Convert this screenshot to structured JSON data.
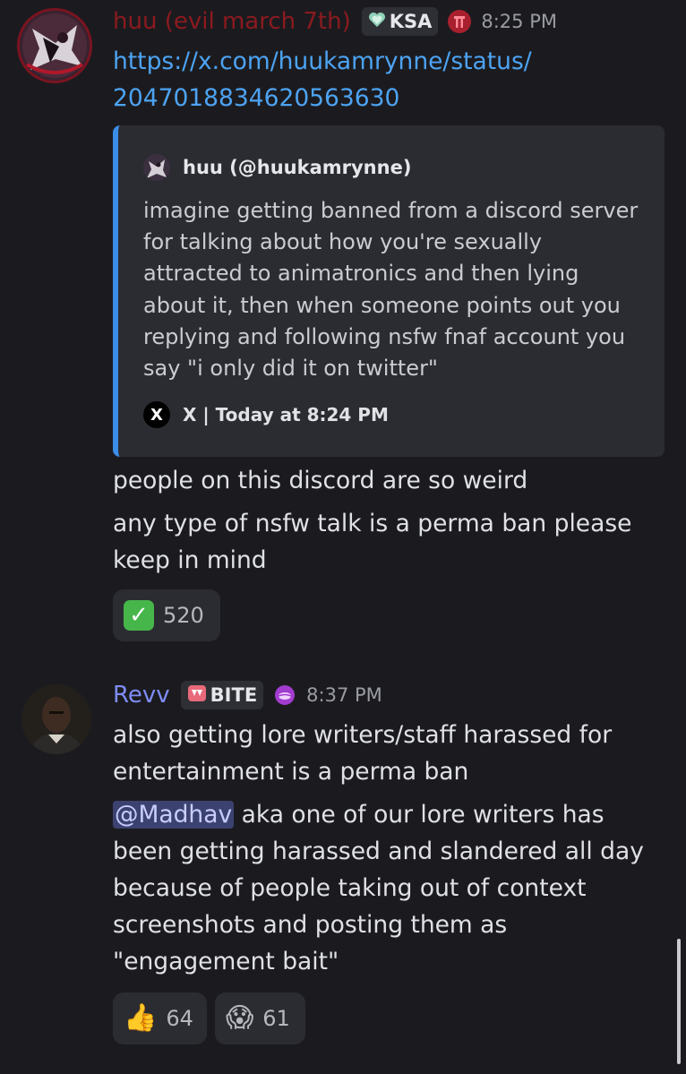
{
  "messages": [
    {
      "username": "huu (evil march 7th)",
      "username_color": "#8b1a1f",
      "tag": {
        "icon": "green-heart-icon",
        "label": "KSA"
      },
      "role_icon": "red-shrine-icon",
      "time": "8:25 PM",
      "link_lines": [
        "https://x.com/huukamrynne/status/",
        "2047018834620563630"
      ],
      "embed": {
        "author": "huu (@huukamrynne)",
        "body": "imagine getting banned from a discord server for talking about how you're sexually attracted to animatronics and then lying about it, then when someone points out you replying and following nsfw fnaf account you say \"i only did it on twitter\"",
        "footer_icon": "X",
        "footer": "X | Today at 8:24 PM",
        "accent_color": "#3a8ee8"
      },
      "lines": [
        "people on this discord are so weird",
        "any type of nsfw talk is a perma ban please keep in mind"
      ],
      "reactions": [
        {
          "emoji": "✅",
          "count": "520"
        }
      ]
    },
    {
      "username": "Revv",
      "username_color": "#7f8cf6",
      "tag": {
        "icon": "fangs-icon",
        "label": "BITE"
      },
      "role_icon": "purple-lips-icon",
      "time": "8:37 PM",
      "line1": "also getting lore writers/staff harassed for entertainment is a perma ban",
      "mention": "@Madhav",
      "line2_rest": " aka one of our lore writers has been getting harassed and slandered all day because of people taking out of context screenshots and posting them as \"engagement bait\"",
      "reactions": [
        {
          "emoji": "👍",
          "count": "64"
        },
        {
          "emoji": "😱",
          "count": "61"
        }
      ]
    }
  ]
}
